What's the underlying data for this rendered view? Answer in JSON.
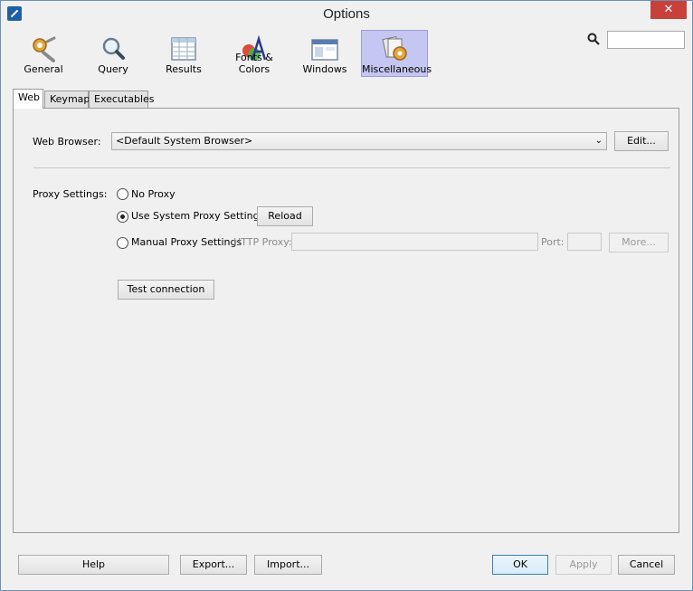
{
  "window": {
    "title": "Options",
    "close_glyph": "✕"
  },
  "toolbar": {
    "items": [
      {
        "label": "General",
        "icon": "gears-icon"
      },
      {
        "label": "Query",
        "icon": "magnifier-icon"
      },
      {
        "label": "Results",
        "icon": "grid-icon"
      },
      {
        "label": "Fonts & Colors",
        "icon": "fonts-colors-icon"
      },
      {
        "label": "Windows",
        "icon": "windows-icon"
      },
      {
        "label": "Miscellaneous",
        "icon": "miscellaneous-icon"
      }
    ],
    "active": "Miscellaneous",
    "search": {
      "value": "",
      "placeholder": ""
    }
  },
  "tabs": [
    {
      "label": "Web"
    },
    {
      "label": "Keymap"
    },
    {
      "label": "Executables"
    }
  ],
  "web": {
    "browser_label": "Web Browser:",
    "browser_value": "<Default System Browser>",
    "browser_arrow": "⌄",
    "edit_button": "Edit...",
    "proxy_label": "Proxy Settings:",
    "no_proxy": "No Proxy",
    "system_proxy": "Use System Proxy Settings",
    "reload_button": "Reload",
    "manual_proxy": "Manual Proxy Settings",
    "http_proxy_label": "HTTP Proxy:",
    "http_proxy_value": "",
    "port_label": "Port:",
    "port_value": "",
    "more_button": "More...",
    "test_button": "Test connection",
    "selected_proxy": "system"
  },
  "footer": {
    "help": "Help",
    "export": "Export...",
    "import": "Import...",
    "ok": "OK",
    "apply": "Apply",
    "cancel": "Cancel"
  }
}
